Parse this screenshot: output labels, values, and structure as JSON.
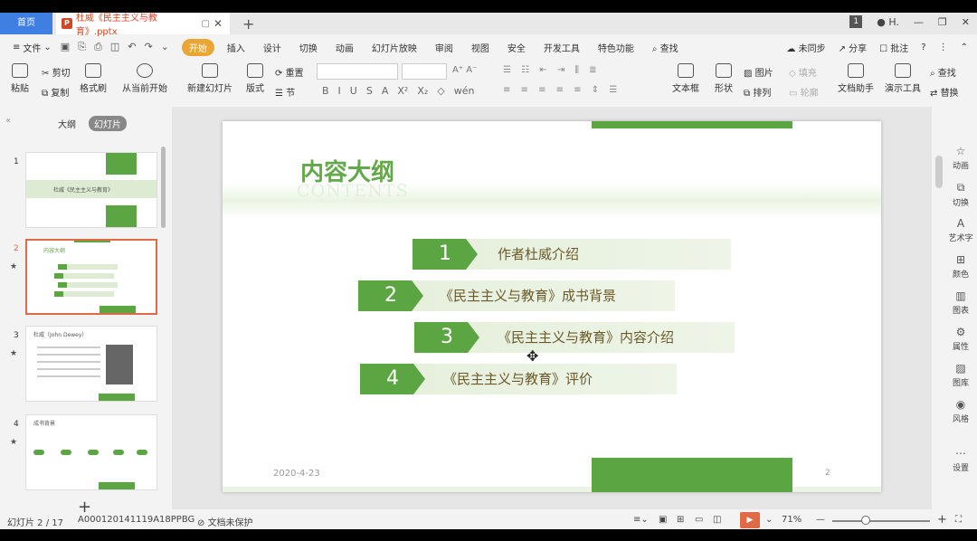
{
  "titlebar": {
    "home_tab": "首页",
    "doc_tab": "杜威《民主主义与教育》.pptx",
    "doc_icon": "P",
    "badge": "1",
    "user": "H."
  },
  "menubar": {
    "file": "文件",
    "items": [
      "开始",
      "插入",
      "设计",
      "切换",
      "动画",
      "幻灯片放映",
      "审阅",
      "视图",
      "安全",
      "开发工具",
      "特色功能"
    ],
    "search": "查找",
    "right": [
      "未同步",
      "分享",
      "批注"
    ]
  },
  "ribbon": {
    "paste": "粘贴",
    "cut": "剪切",
    "copy": "复制",
    "format_painter": "格式刷",
    "from_current": "从当前开始",
    "new_slide": "新建幻灯片",
    "layout": "版式",
    "reset": "重置",
    "section": "节",
    "textbox": "文本框",
    "shape": "形状",
    "picture": "图片",
    "arrange": "排列",
    "fill": "填充",
    "outline": "轮廓",
    "doc_helper": "文档助手",
    "present_tools": "演示工具",
    "find": "查找",
    "replace": "替换",
    "fmt": [
      "B",
      "I",
      "U",
      "S",
      "A",
      "X²",
      "X₂",
      "◇",
      "wén"
    ]
  },
  "leftpanel": {
    "tabs": [
      "大纲",
      "幻灯片"
    ],
    "active_tab": "幻灯片",
    "slides": [
      {
        "num": "1",
        "title": "杜威《民主主义与教育》"
      },
      {
        "num": "2",
        "title": "内容大纲"
      },
      {
        "num": "3",
        "title": "杜威（John Dewey）"
      },
      {
        "num": "4",
        "title": "成书背景"
      }
    ]
  },
  "slide": {
    "title": "内容大纲",
    "subtitle": "CONTENTS",
    "items": [
      {
        "num": "1",
        "text": "作者杜威介绍"
      },
      {
        "num": "2",
        "text": "《民主主义与教育》成书背景"
      },
      {
        "num": "3",
        "text": "《民主主义与教育》内容介绍"
      },
      {
        "num": "4",
        "text": "《民主主义与教育》评价"
      }
    ],
    "date": "2020-4-23",
    "page": "2"
  },
  "rightbar": [
    "动画",
    "切换",
    "艺术字",
    "颜色",
    "图表",
    "属性",
    "图库",
    "风格",
    "设置"
  ],
  "statusbar": {
    "slide_pos": "幻灯片 2 / 17",
    "template": "A000120141119A18PPBG",
    "protect": "文档未保护",
    "zoom": "71%"
  },
  "colors": {
    "accent_green": "#5ca543",
    "title_green": "#63a84a",
    "home_blue": "#3f7fe2",
    "active_orange": "#e8a735",
    "selection": "#e06a46"
  }
}
